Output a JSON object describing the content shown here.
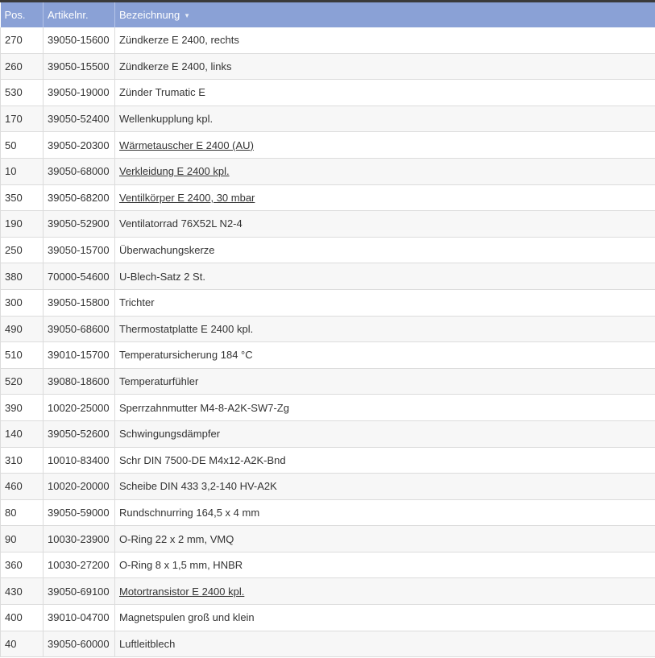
{
  "table": {
    "headers": {
      "pos": "Pos.",
      "artikelnr": "Artikelnr.",
      "bezeichnung": "Bezeichnung"
    },
    "sort_icon": "chevron-down-icon",
    "rows": [
      {
        "pos": "270",
        "artikelnr": "39050-15600",
        "bezeichnung": "Zündkerze E 2400, rechts",
        "link": false
      },
      {
        "pos": "260",
        "artikelnr": "39050-15500",
        "bezeichnung": "Zündkerze E 2400, links",
        "link": false
      },
      {
        "pos": "530",
        "artikelnr": "39050-19000",
        "bezeichnung": "Zünder Trumatic E",
        "link": false
      },
      {
        "pos": "170",
        "artikelnr": "39050-52400",
        "bezeichnung": "Wellenkupplung kpl.",
        "link": false
      },
      {
        "pos": "50",
        "artikelnr": "39050-20300",
        "bezeichnung": "Wärmetauscher E 2400 (AU)",
        "link": true
      },
      {
        "pos": "10",
        "artikelnr": "39050-68000",
        "bezeichnung": "Verkleidung E 2400 kpl.",
        "link": true
      },
      {
        "pos": "350",
        "artikelnr": "39050-68200",
        "bezeichnung": "Ventilkörper E 2400, 30 mbar",
        "link": true
      },
      {
        "pos": "190",
        "artikelnr": "39050-52900",
        "bezeichnung": "Ventilatorrad 76X52L N2-4",
        "link": false
      },
      {
        "pos": "250",
        "artikelnr": "39050-15700",
        "bezeichnung": "Überwachungskerze",
        "link": false
      },
      {
        "pos": "380",
        "artikelnr": "70000-54600",
        "bezeichnung": "U-Blech-Satz 2 St.",
        "link": false
      },
      {
        "pos": "300",
        "artikelnr": "39050-15800",
        "bezeichnung": "Trichter",
        "link": false
      },
      {
        "pos": "490",
        "artikelnr": "39050-68600",
        "bezeichnung": "Thermostatplatte E 2400 kpl.",
        "link": false
      },
      {
        "pos": "510",
        "artikelnr": "39010-15700",
        "bezeichnung": "Temperatursicherung 184 °C",
        "link": false
      },
      {
        "pos": "520",
        "artikelnr": "39080-18600",
        "bezeichnung": "Temperaturfühler",
        "link": false
      },
      {
        "pos": "390",
        "artikelnr": "10020-25000",
        "bezeichnung": "Sperrzahnmutter M4-8-A2K-SW7-Zg",
        "link": false
      },
      {
        "pos": "140",
        "artikelnr": "39050-52600",
        "bezeichnung": "Schwingungsdämpfer",
        "link": false
      },
      {
        "pos": "310",
        "artikelnr": "10010-83400",
        "bezeichnung": "Schr DIN 7500-DE M4x12-A2K-Bnd",
        "link": false
      },
      {
        "pos": "460",
        "artikelnr": "10020-20000",
        "bezeichnung": "Scheibe DIN 433 3,2-140 HV-A2K",
        "link": false
      },
      {
        "pos": "80",
        "artikelnr": "39050-59000",
        "bezeichnung": "Rundschnurring 164,5 x 4 mm",
        "link": false
      },
      {
        "pos": "90",
        "artikelnr": "10030-23900",
        "bezeichnung": "O-Ring 22 x 2 mm, VMQ",
        "link": false
      },
      {
        "pos": "360",
        "artikelnr": "10030-27200",
        "bezeichnung": "O-Ring 8 x 1,5 mm, HNBR",
        "link": false
      },
      {
        "pos": "430",
        "artikelnr": "39050-69100",
        "bezeichnung": "Motortransistor E 2400 kpl.",
        "link": true
      },
      {
        "pos": "400",
        "artikelnr": "39010-04700",
        "bezeichnung": "Magnetspulen groß und klein",
        "link": false
      },
      {
        "pos": "40",
        "artikelnr": "39050-60000",
        "bezeichnung": "Luftleitblech",
        "link": false
      }
    ]
  }
}
